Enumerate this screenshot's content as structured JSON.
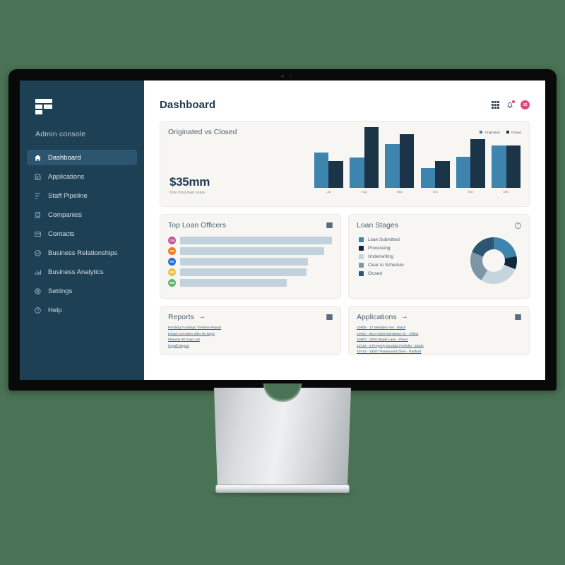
{
  "background_color": "#4a7254",
  "sidebar": {
    "logo_name": "brand-logo",
    "console_label": "Admin console",
    "items": [
      {
        "label": "Dashboard",
        "icon": "home-icon",
        "active": true
      },
      {
        "label": "Applications",
        "icon": "document-icon",
        "active": false
      },
      {
        "label": "Staff Pipeline",
        "icon": "pipeline-icon",
        "active": false
      },
      {
        "label": "Companies",
        "icon": "building-icon",
        "active": false
      },
      {
        "label": "Contacts",
        "icon": "contact-card-icon",
        "active": false
      },
      {
        "label": "Business Relationships",
        "icon": "handshake-icon",
        "active": false
      },
      {
        "label": "Business Analytics",
        "icon": "analytics-icon",
        "active": false
      },
      {
        "label": "Settings",
        "icon": "gear-icon",
        "active": false
      },
      {
        "label": "Help",
        "icon": "question-circle-icon",
        "active": false
      }
    ],
    "colors": {
      "background": "#1e4054",
      "active": "#2c5670",
      "text": "#d3dde4"
    }
  },
  "header": {
    "title": "Dashboard",
    "apps_icon": "apps-grid-icon",
    "bell_icon": "bell-icon",
    "avatar_initials": "JD",
    "avatar_color": "#e0457b",
    "notification_dot_color": "#e0457b"
  },
  "chart_card": {
    "title": "Originated vs Closed",
    "hero_value": "$35mm",
    "hero_subtitle": "6mo total loan value",
    "list_icon": "list-icon"
  },
  "chart_data": {
    "type": "bar",
    "title": "Originated vs Closed",
    "categories": [
      "Jul",
      "Aug",
      "Sep",
      "Oct",
      "Nov",
      "Dec"
    ],
    "series": [
      {
        "name": "Originated",
        "color": "#3d84ae",
        "values": [
          58,
          50,
          72,
          32,
          51,
          70
        ]
      },
      {
        "name": "Closed",
        "color": "#1c3448",
        "values": [
          44,
          100,
          88,
          44,
          80,
          70
        ]
      }
    ],
    "xlabel": "",
    "ylabel": "",
    "ylim": [
      0,
      100
    ],
    "grid": false,
    "legend_position": "top-right"
  },
  "officers_card": {
    "title": "Top Loan Officers",
    "list_icon": "list-icon",
    "rows": [
      {
        "initials": "CW",
        "color": "#c2548f",
        "bar_percent": 100
      },
      {
        "initials": "AM",
        "color": "#ef7c1a",
        "bar_percent": 88
      },
      {
        "initials": "HO",
        "color": "#1f6fd6",
        "bar_percent": 78
      },
      {
        "initials": "BM",
        "color": "#e4c241",
        "bar_percent": 77
      },
      {
        "initials": "EM",
        "color": "#63b56b",
        "bar_percent": 65
      }
    ]
  },
  "stages_card": {
    "title": "Loan Stages",
    "help_icon": "help-circle-icon"
  },
  "stages_chart": {
    "type": "pie",
    "title": "Loan Stages",
    "labels": [
      "Loan Submitted",
      "Processing",
      "Underwriting",
      "Clear to Schedule",
      "Closed"
    ],
    "values": [
      22,
      9,
      28,
      22,
      19
    ],
    "colors": [
      "#3d84ae",
      "#11283a",
      "#c5d5de",
      "#7e96a3",
      "#2e5670"
    ],
    "legend_position": "left"
  },
  "reports_card": {
    "title": "Reports",
    "arrow": "→",
    "list_icon": "list-icon",
    "links": [
      "Pending Fundings Timeline Report",
      "Draws not taken after 90 Days",
      "Maturity 90 Days out",
      "Payoff Report"
    ]
  },
  "applications_card": {
    "title": "Applications",
    "arrow": "→",
    "list_icon": "list-icon",
    "links": [
      "10905 - 17 Meridian Ave - Black",
      "10911 - 5514-5516 Bordeaux St. - White",
      "10657 - 2209 Maple Lane - Perez",
      "10728 - 6 Property Nevada Portfolio - Davis",
      "10741 - 13207 Paramount Drive - Radford"
    ]
  }
}
